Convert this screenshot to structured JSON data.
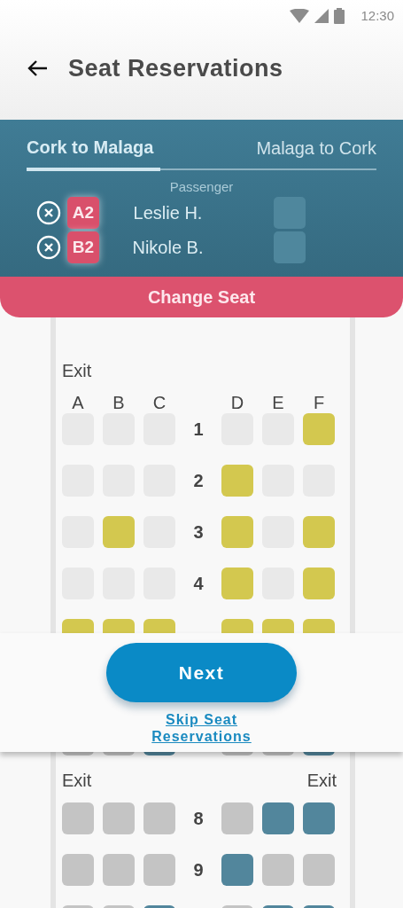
{
  "status_bar": {
    "time": "12:30"
  },
  "header": {
    "title": "Seat Reservations"
  },
  "tabs": [
    {
      "label": "Cork to Malaga",
      "selected": true
    },
    {
      "label": "Malaga to Cork",
      "selected": false
    }
  ],
  "passengers": {
    "heading": "Passenger",
    "rows": [
      {
        "seat": "A2",
        "name": "Leslie H."
      },
      {
        "seat": "B2",
        "name": "Nikole B."
      }
    ]
  },
  "change_seat_button": "Change Seat",
  "seat_map": {
    "kind": "normal",
    "exit_label": "Exit",
    "columns": [
      "A",
      "B",
      "C",
      "D",
      "E",
      "F"
    ],
    "rows": [
      {
        "number": "1",
        "seats": [
          {
            "available": false
          },
          {
            "available": false
          },
          {
            "available": false
          },
          {
            "available": false
          },
          {
            "available": false
          },
          {
            "available": true
          }
        ]
      },
      {
        "number": "2",
        "seats": [
          {
            "available": false
          },
          {
            "available": false
          },
          {
            "available": false
          },
          {
            "available": true
          },
          {
            "available": false
          },
          {
            "available": false
          }
        ]
      },
      {
        "number": "3",
        "seats": [
          {
            "available": false
          },
          {
            "available": true
          },
          {
            "available": false
          },
          {
            "available": true
          },
          {
            "available": false
          },
          {
            "available": true
          }
        ]
      },
      {
        "number": "4",
        "seats": [
          {
            "available": false
          },
          {
            "available": false
          },
          {
            "available": false
          },
          {
            "available": true
          },
          {
            "available": false
          },
          {
            "available": true
          }
        ]
      },
      {
        "seats": [
          {
            "available": true
          },
          {
            "available": true
          },
          {
            "available": true
          },
          {
            "available": true
          },
          {
            "available": true
          },
          {
            "available": true
          }
        ]
      }
    ]
  },
  "next_button": "Next",
  "skip_link": "Skip Seat Reservations",
  "seat_map_lower": {
    "kind": "dimmed",
    "exit_labels": [
      "Exit",
      "Exit"
    ],
    "rows": [
      {
        "seats": [
          {
            "available": false
          },
          {
            "available": false
          },
          {
            "available": true
          },
          {
            "available": false
          },
          {
            "available": false
          },
          {
            "available": true
          }
        ]
      },
      {
        "number": "8",
        "seats": [
          {
            "available": false
          },
          {
            "available": false
          },
          {
            "available": false
          },
          {
            "available": false
          },
          {
            "available": true
          },
          {
            "available": true
          }
        ]
      },
      {
        "number": "9",
        "seats": [
          {
            "available": false
          },
          {
            "available": false
          },
          {
            "available": false
          },
          {
            "available": true
          },
          {
            "available": false
          },
          {
            "available": false
          }
        ]
      },
      {
        "seats": [
          {
            "available": false
          },
          {
            "available": false
          },
          {
            "available": true
          },
          {
            "available": false
          },
          {
            "available": true
          },
          {
            "available": true
          }
        ]
      }
    ]
  }
}
